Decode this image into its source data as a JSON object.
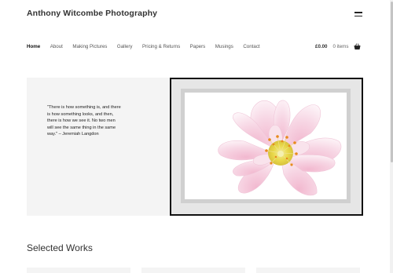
{
  "site": {
    "title": "Anthony Witcombe Photography"
  },
  "nav": {
    "items": [
      {
        "label": "Home",
        "active": true
      },
      {
        "label": "About"
      },
      {
        "label": "Making Pictures"
      },
      {
        "label": "Gallery"
      },
      {
        "label": "Pricing & Returns"
      },
      {
        "label": "Papers"
      },
      {
        "label": "Musings"
      },
      {
        "label": "Contact"
      }
    ]
  },
  "cart": {
    "amount": "£0.00",
    "count": "0 items"
  },
  "hero": {
    "quote": "\"There is how something is, and there is how something looks, and then, there is how we see it.  No two men will see the same thing in the same way.\" – Jeremiah Langdon"
  },
  "sections": {
    "selected_works_title": "Selected Works"
  },
  "colors": {
    "frame": "#111111",
    "mat": "#d0d0d0",
    "hero_background": "#f4f4f4",
    "petal_pink": "#f4c9dc",
    "stamen_yellow": "#e9d84a",
    "anther_orange": "#e88a1e"
  }
}
